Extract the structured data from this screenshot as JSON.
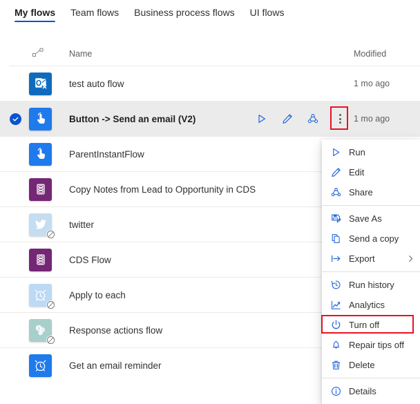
{
  "tabs": [
    {
      "label": "My flows",
      "active": true
    },
    {
      "label": "Team flows",
      "active": false
    },
    {
      "label": "Business process flows",
      "active": false
    },
    {
      "label": "UI flows",
      "active": false
    }
  ],
  "columns": {
    "connector_icon": "link-icon",
    "name": "Name",
    "modified": "Modified"
  },
  "rows": [
    {
      "name": "test auto flow",
      "modified": "1 mo ago",
      "icon": "outlook-icon",
      "icon_bg": "#0f6cbd",
      "disabled": false,
      "selected": false
    },
    {
      "name": "Button -> Send an email (V2)",
      "modified": "1 mo ago",
      "icon": "button-tap-icon",
      "icon_bg": "#1f7aec",
      "disabled": false,
      "selected": true
    },
    {
      "name": "ParentInstantFlow",
      "modified": "",
      "icon": "button-tap-icon",
      "icon_bg": "#1f7aec",
      "disabled": false,
      "selected": false
    },
    {
      "name": "Copy Notes from Lead to Opportunity in CDS",
      "modified": "",
      "icon": "database-icon",
      "icon_bg": "#742774",
      "disabled": false,
      "selected": false
    },
    {
      "name": "twitter",
      "modified": "",
      "icon": "twitter-icon",
      "icon_bg": "#c5ddf0",
      "disabled": true,
      "selected": false
    },
    {
      "name": "CDS Flow",
      "modified": "",
      "icon": "database-icon",
      "icon_bg": "#742774",
      "disabled": false,
      "selected": false
    },
    {
      "name": "Apply to each",
      "modified": "",
      "icon": "alarm-clock-icon",
      "icon_bg": "#bcd9f5",
      "disabled": true,
      "selected": false
    },
    {
      "name": "Response actions flow",
      "modified": "",
      "icon": "sharepoint-icon",
      "icon_bg": "#a9cfcb",
      "disabled": true,
      "selected": false
    },
    {
      "name": "Get an email reminder",
      "modified": "",
      "icon": "alarm-clock-icon",
      "icon_bg": "#1f7aec",
      "disabled": false,
      "selected": false
    }
  ],
  "row_actions": [
    {
      "name": "run-action",
      "icon": "play-icon"
    },
    {
      "name": "edit-action",
      "icon": "pencil-icon"
    },
    {
      "name": "share-action",
      "icon": "share-icon"
    },
    {
      "name": "more-commands-action",
      "icon": "more-vertical-icon"
    }
  ],
  "context_menu": {
    "items": [
      {
        "label": "Run",
        "icon": "play-icon",
        "sep_after": false,
        "submenu": false,
        "highlight": false
      },
      {
        "label": "Edit",
        "icon": "pencil-icon",
        "sep_after": false,
        "submenu": false,
        "highlight": false
      },
      {
        "label": "Share",
        "icon": "share-icon",
        "sep_after": true,
        "submenu": false,
        "highlight": false
      },
      {
        "label": "Save As",
        "icon": "save-as-icon",
        "sep_after": false,
        "submenu": false,
        "highlight": false
      },
      {
        "label": "Send a copy",
        "icon": "copy-icon",
        "sep_after": false,
        "submenu": false,
        "highlight": false
      },
      {
        "label": "Export",
        "icon": "export-icon",
        "sep_after": true,
        "submenu": true,
        "highlight": false
      },
      {
        "label": "Run history",
        "icon": "history-icon",
        "sep_after": false,
        "submenu": false,
        "highlight": false
      },
      {
        "label": "Analytics",
        "icon": "analytics-icon",
        "sep_after": false,
        "submenu": false,
        "highlight": false
      },
      {
        "label": "Turn off",
        "icon": "power-icon",
        "sep_after": false,
        "submenu": false,
        "highlight": true
      },
      {
        "label": "Repair tips off",
        "icon": "bell-icon",
        "sep_after": false,
        "submenu": false,
        "highlight": false
      },
      {
        "label": "Delete",
        "icon": "trash-icon",
        "sep_after": true,
        "submenu": false,
        "highlight": false
      },
      {
        "label": "Details",
        "icon": "info-icon",
        "sep_after": false,
        "submenu": false,
        "highlight": false
      }
    ]
  },
  "colors": {
    "accent": "#0b53ce",
    "icon_blue": "#2266dd",
    "highlight_red": "#e81123",
    "selected_row_bg": "#ebebeb",
    "divider": "#edebe9"
  }
}
